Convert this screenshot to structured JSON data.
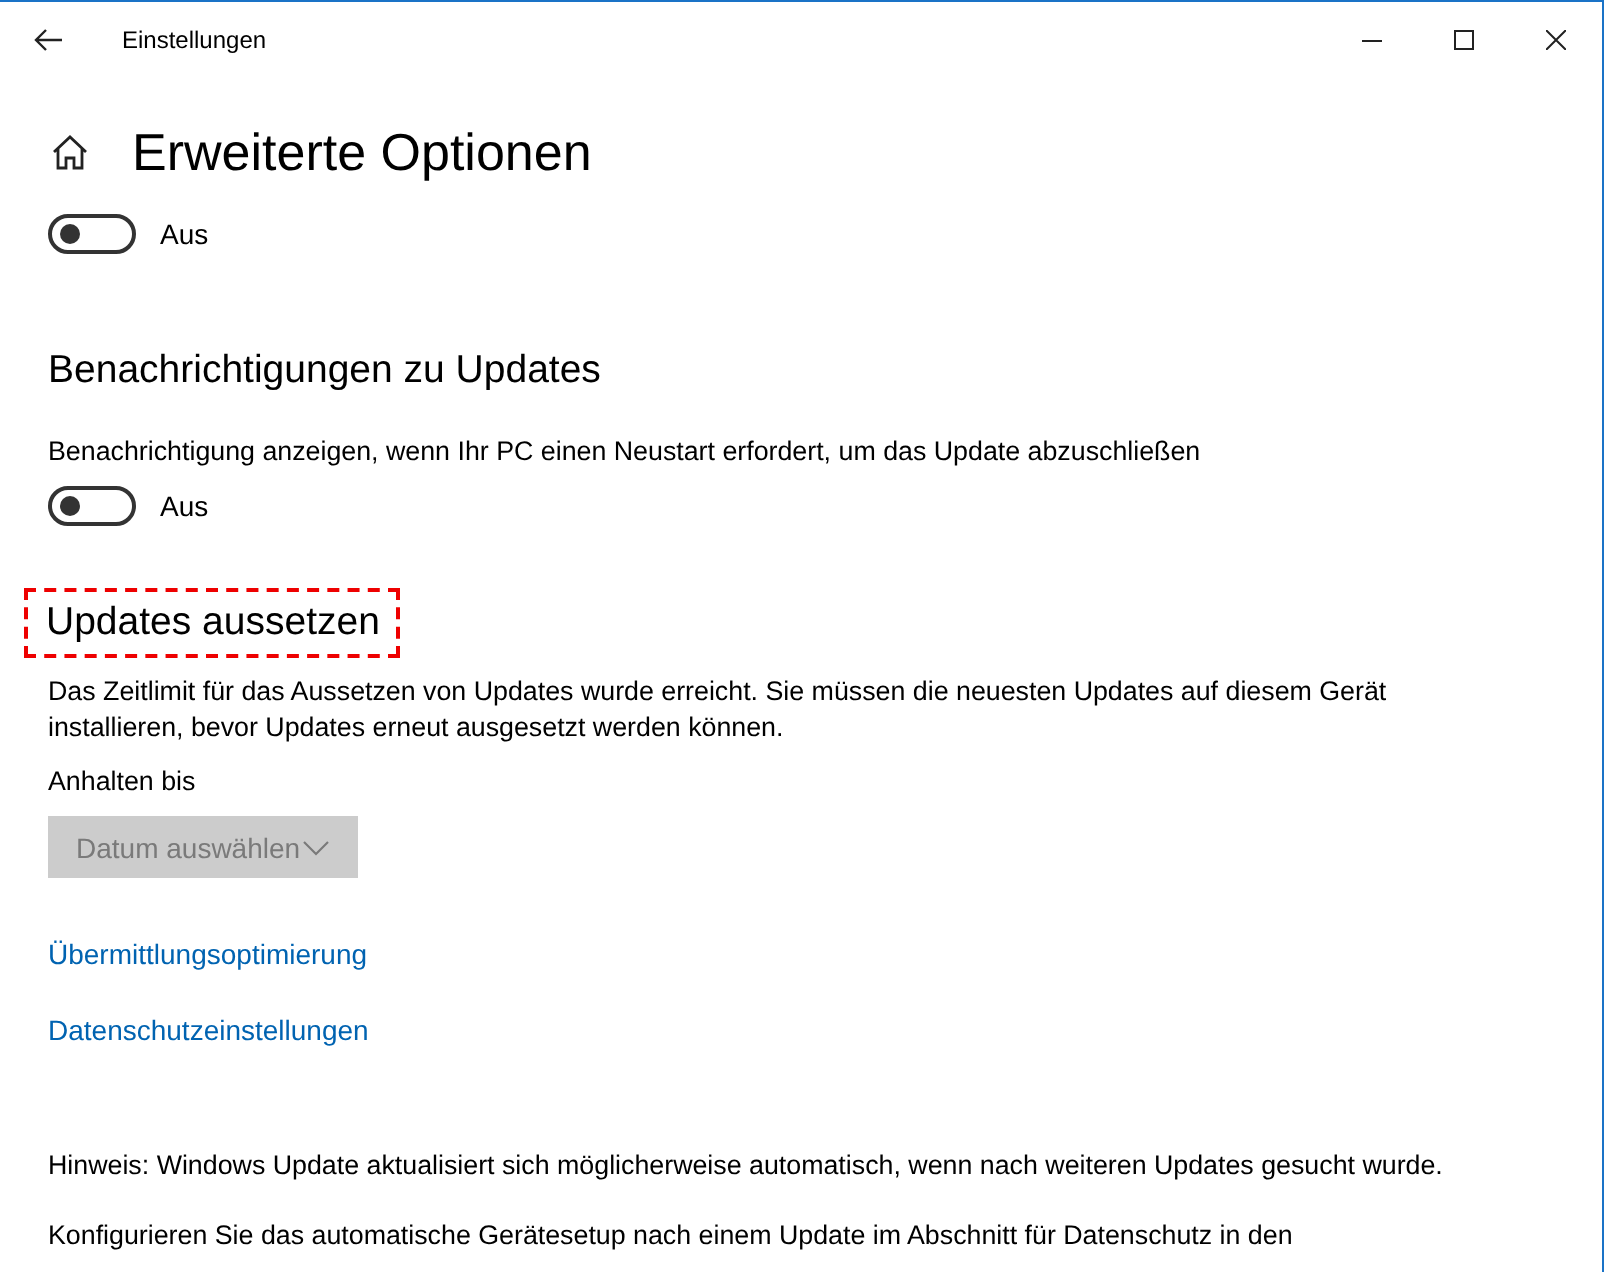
{
  "window": {
    "title": "Einstellungen"
  },
  "page": {
    "title": "Erweiterte Optionen"
  },
  "sections": [
    {
      "kind": "toggle",
      "toggle": {
        "on": false,
        "label": "Aus"
      }
    },
    {
      "kind": "setting",
      "heading": {
        "text": "Benachrichtigungen zu Updates",
        "highlighted": false
      },
      "description": "Benachrichtigung anzeigen, wenn Ihr PC einen Neustart erfordert, um das Update abzuschließen",
      "toggle": {
        "on": false,
        "label": "Aus"
      }
    },
    {
      "kind": "pause",
      "heading": {
        "text": "Updates aussetzen",
        "highlighted": true
      },
      "description": "Das Zeitlimit für das Aussetzen von Updates wurde erreicht. Sie müssen die neuesten Updates auf diesem Gerät installieren, bevor Updates erneut ausgesetzt werden können.",
      "field_label": "Anhalten bis",
      "dropdown": {
        "value": "Datum auswählen",
        "disabled": true
      }
    },
    {
      "kind": "links",
      "links": [
        "Übermittlungsoptimierung",
        "Datenschutzeinstellungen"
      ]
    },
    {
      "kind": "note",
      "text": "Hinweis: Windows Update aktualisiert sich möglicherweise automatisch, wenn nach weiteren Updates gesucht wurde."
    },
    {
      "kind": "note",
      "text": "Konfigurieren Sie das automatische Gerätesetup nach einem Update im Abschnitt für Datenschutz in den"
    }
  ]
}
